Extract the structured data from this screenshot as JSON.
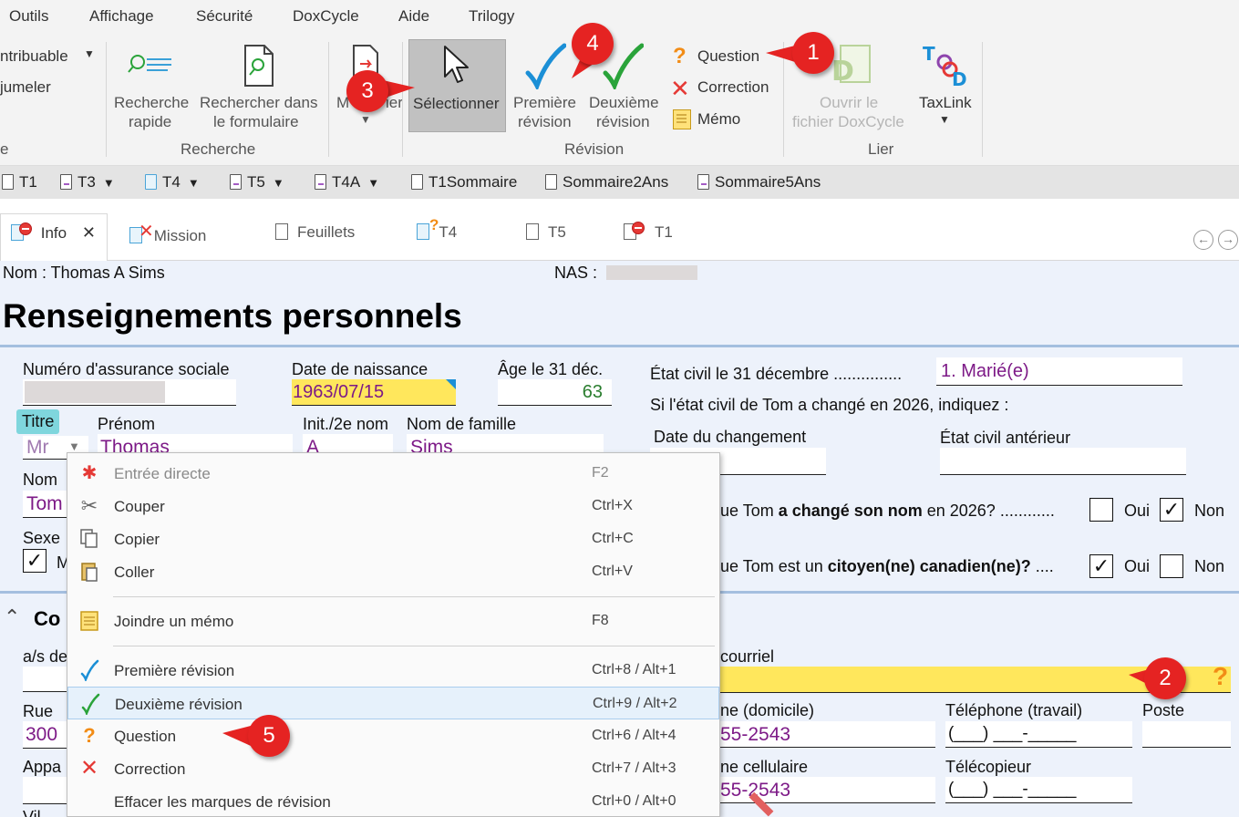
{
  "menubar": {
    "items": [
      "Outils",
      "Affichage",
      "Sécurité",
      "DoxCycle",
      "Aide",
      "Trilogy"
    ]
  },
  "ribbon": {
    "contribuable_label": "ntribuable",
    "jumeler_label": "jumeler",
    "recherche_rapide_l1": "Recherche",
    "recherche_rapide_l2": "rapide",
    "rechercher_formulaire_l1": "Rechercher dans",
    "rechercher_formulaire_l2": "le formulaire",
    "group_recherche": "Recherche",
    "modifier_label": "M",
    "modifier_label_tail": "ier",
    "selectionner_label": "Sélectionner",
    "premiere_revision_l1": "Première",
    "premiere_revision_l2": "révision",
    "deuxieme_revision_l1": "Deuxième",
    "deuxieme_revision_l2": "révision",
    "question_label": "Question",
    "correction_label": "Correction",
    "memo_label": "Mémo",
    "group_revision": "Révision",
    "ouvrir_l1": "Ouvrir le",
    "ouvrir_l2": "fichier DoxCycle",
    "taxlink_label": "TaxLink",
    "group_lier": "Lier",
    "left_group_fragment": "e"
  },
  "forms": {
    "items": [
      {
        "label": "T1",
        "dropdown": false
      },
      {
        "label": "T3",
        "dropdown": true
      },
      {
        "label": "T4",
        "dropdown": true
      },
      {
        "label": "T5",
        "dropdown": true
      },
      {
        "label": "T4A",
        "dropdown": true
      },
      {
        "label": "T1Sommaire",
        "dropdown": false
      },
      {
        "label": "Sommaire2Ans",
        "dropdown": false
      },
      {
        "label": "Sommaire5Ans",
        "dropdown": false
      }
    ]
  },
  "tabs": {
    "items": [
      "Info",
      "Mission",
      "Feuillets",
      "T4",
      "T5",
      "T1"
    ],
    "close": "✕",
    "nav_back": "←",
    "nav_fwd": "→"
  },
  "header": {
    "nom": "Nom : Thomas A Sims",
    "nas_label": "NAS :"
  },
  "form": {
    "title": "Renseignements personnels",
    "nas_label": "Numéro d'assurance sociale",
    "dob_label": "Date de naissance",
    "dob_value": "1963/07/15",
    "age_label": "Âge le 31 déc.",
    "age_value": "63",
    "etat_civil_label": "État civil le 31 décembre ...............",
    "etat_civil_value": "1. Marié(e)",
    "changement_text": "Si l'état civil de Tom a changé en 2026, indiquez :",
    "date_changement_label": "Date du changement",
    "etat_anterieur_label": "État civil antérieur",
    "titre_label": "Titre",
    "titre_value": "Mr",
    "prenom_label": "Prénom",
    "prenom_value": "Thomas",
    "init_label": "Init./2e nom",
    "init_value": "A",
    "famille_label": "Nom de famille",
    "famille_value": "Sims",
    "nom_label": "Nom",
    "nom_value": "Tom",
    "sexe_label": "Sexe",
    "sexe_m": "M",
    "q_nom_pre": "ue Tom ",
    "q_nom_bold": "a changé son nom",
    "q_nom_post": " en 2026? ............",
    "q_cit_pre": "ue Tom est un ",
    "q_cit_bold": "citoyen(ne) canadien(ne)?",
    "q_cit_post": " ....",
    "oui": "Oui",
    "non": "Non",
    "check_mark": "✓",
    "section_co": "Co",
    "as_label": "a/s de",
    "courriel_label": "courriel",
    "rue_label": "Rue",
    "rue_value": "300",
    "tel_dom_label": "ne (domicile)",
    "tel_dom_value": "55-2543",
    "tel_trav_label": "Téléphone (travail)",
    "tel_trav_value": "(___) ___-_____",
    "poste_label": "Poste",
    "appa_label": "Appa",
    "cell_label": "ne cellulaire",
    "cell_value": "55-2543",
    "fax_label": "Télécopieur",
    "fax_value": "(___) ___-_____",
    "vil_label": "Vil"
  },
  "context_menu": {
    "items": [
      {
        "label": "Entrée directe",
        "shortcut": "F2"
      },
      {
        "label": "Couper",
        "shortcut": "Ctrl+X"
      },
      {
        "label": "Copier",
        "shortcut": "Ctrl+C"
      },
      {
        "label": "Coller",
        "shortcut": "Ctrl+V"
      },
      {
        "label": "Joindre un mémo",
        "shortcut": "F8"
      },
      {
        "label": "Première révision",
        "shortcut": "Ctrl+8 / Alt+1"
      },
      {
        "label": "Deuxième révision",
        "shortcut": "Ctrl+9 / Alt+2"
      },
      {
        "label": "Question",
        "shortcut": "Ctrl+6 / Alt+4"
      },
      {
        "label": "Correction",
        "shortcut": "Ctrl+7 / Alt+3"
      },
      {
        "label": "Effacer les marques de révision",
        "shortcut": "Ctrl+0 / Alt+0"
      }
    ]
  },
  "callouts": [
    "1",
    "2",
    "3",
    "4",
    "5"
  ],
  "colors": {
    "value_purple": "#7d1a87",
    "highlight_yellow": "#ffe75c",
    "callout_red": "#e52322",
    "check_blue": "#1b8fd6",
    "check_green": "#2aa33a",
    "question_orange": "#f28c16",
    "correction_red": "#e53935"
  }
}
